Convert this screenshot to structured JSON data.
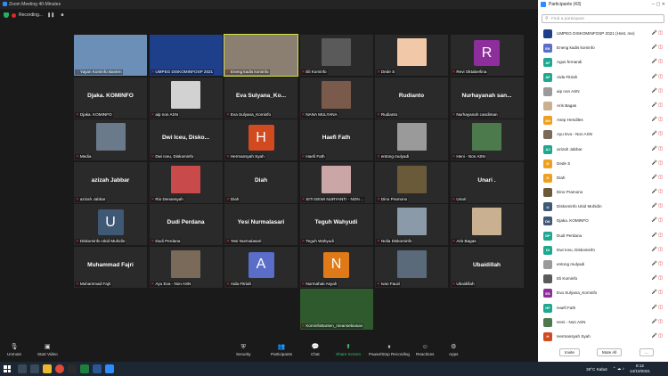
{
  "window": {
    "title": "Zoom Meeting 40-Minutes"
  },
  "recording": {
    "label": "Recording...",
    "pause_icon": "pause-icon",
    "stop_icon": "stop-icon"
  },
  "tiles": [
    {
      "name": "Yayan Kominfo Banten",
      "type": "photo",
      "color": "#6b8fb6"
    },
    {
      "name": "UMPEG DISKOMINFOSP 2021",
      "type": "photo",
      "color": "#1e3f8a"
    },
    {
      "name": "Eneng kadis kominfo",
      "type": "photo",
      "color": "#8a7f70",
      "active": true
    },
    {
      "name": "Eli Kominfo",
      "type": "photo",
      "color": "#5a5a5a"
    },
    {
      "name": "Dede S",
      "type": "photo",
      "color": "#f2c9a8"
    },
    {
      "name": "Revi Oktaberlina",
      "type": "avatar",
      "letter": "R",
      "color": "#8e2e9c"
    },
    {
      "name": "Djaka. KOMINFO",
      "type": "text",
      "big": "Djaka. KOMINFO"
    },
    {
      "name": "aip non ASN",
      "type": "photo",
      "color": "#d2d2d2"
    },
    {
      "name": "Eva Sulyana_Kominfo",
      "type": "text",
      "big": "Eva Sulyana_Ko..."
    },
    {
      "name": "NANA MULYANA",
      "type": "photo",
      "color": "#7a5a4a"
    },
    {
      "name": "Rudianto",
      "type": "text",
      "big": "Rudianto"
    },
    {
      "name": "Nurhayanah candiman",
      "type": "text",
      "big": "Nurhayanah san..."
    },
    {
      "name": "Media",
      "type": "photo",
      "color": "#6a7a8a"
    },
    {
      "name": "Dwi Iceu, Diskominfo",
      "type": "text",
      "big": "Dwi Iceu, Disko..."
    },
    {
      "name": "Hermansyah Syah",
      "type": "avatar",
      "letter": "H",
      "color": "#d24a1f"
    },
    {
      "name": "Haefi Fath",
      "type": "text",
      "big": "Haefi Fath"
    },
    {
      "name": "entong mulyadi",
      "type": "photo",
      "color": "#9a9a9a"
    },
    {
      "name": "Heni - Non ASN",
      "type": "photo",
      "color": "#4d7a4d"
    },
    {
      "name": "azizah Jabbar",
      "type": "text",
      "big": "azizah Jabbar"
    },
    {
      "name": "Rio Denansyah",
      "type": "photo",
      "color": "#c94a4a"
    },
    {
      "name": "Diah",
      "type": "text",
      "big": "Diah"
    },
    {
      "name": "SITI DEWI NURYANTI - NON ...",
      "type": "photo",
      "color": "#caa6a6"
    },
    {
      "name": "Dino Pramono",
      "type": "photo",
      "color": "#6a5a3a"
    },
    {
      "name": "Unari",
      "type": "text",
      "big": "Unari ."
    },
    {
      "name": "Diskominfo Ukid Muhidin",
      "type": "avatar",
      "letter": "U",
      "color": "#3f5873"
    },
    {
      "name": "Dudi Perdana",
      "type": "text",
      "big": "Dudi Perdana"
    },
    {
      "name": "Yesi Nurmalasari",
      "type": "text",
      "big": "Yesi Nurmalasari"
    },
    {
      "name": "Teguh Wahyudi",
      "type": "text",
      "big": "Teguh Wahyudi"
    },
    {
      "name": "Nolia Diskominfo",
      "type": "photo",
      "color": "#8a9aa8"
    },
    {
      "name": "Aris Bagas",
      "type": "photo",
      "color": "#c8b090"
    },
    {
      "name": "Muhammad Fajri",
      "type": "text",
      "big": "Muhammad Fajri"
    },
    {
      "name": "Ayu Eva - Non ASN",
      "type": "photo",
      "color": "#7a6a5a"
    },
    {
      "name": "Aida Fitriah",
      "type": "avatar",
      "letter": "A",
      "color": "#5a6ec9"
    },
    {
      "name": "Nurmahati Asyah",
      "type": "avatar",
      "letter": "N",
      "color": "#e07a18"
    },
    {
      "name": "Ivan Fauzi",
      "type": "photo",
      "color": "#5a6a7a"
    },
    {
      "name": "Ubaidillah",
      "type": "text",
      "big": "Ubaidillah"
    },
    {
      "name": "KominfoBanten_meansebiasan",
      "type": "photo",
      "color": "#2e5a2e"
    }
  ],
  "toolbar": {
    "unmute": "Unmute",
    "start_video": "Start Video",
    "security": "Security",
    "participants": "Participants",
    "participants_count": "43",
    "chat": "Chat",
    "share_screen": "Share Screen",
    "pause_recording": "Pause/Stop Recording",
    "reactions": "Reactions",
    "apps": "Apps"
  },
  "taskbar": {
    "weather": "30°C  Kabut",
    "time": "8:12",
    "date": "14/10/2021"
  },
  "panel": {
    "title": "Participants (43)",
    "search_placeholder": "Find a participant",
    "invite": "Invite",
    "mute_all": "Mute All",
    "more": "..."
  },
  "participants": [
    {
      "name": "UMPEG DISKOMINFOSP 2021 (Host, me)",
      "initials": "",
      "color": "#1e3f8a",
      "photo": true
    },
    {
      "name": "Eneng kadis kominfo",
      "initials": "EK",
      "color": "#5a6ec9",
      "photo": false
    },
    {
      "name": "Agus fernandi",
      "initials": "AF",
      "color": "#1fa88f",
      "photo": false
    },
    {
      "name": "Aida Fitriah",
      "initials": "AF",
      "color": "#1fa88f",
      "photo": false
    },
    {
      "name": "aip non ASN",
      "initials": "",
      "color": "#9a9a9a",
      "photo": true
    },
    {
      "name": "Aris Bagas",
      "initials": "",
      "color": "#c8b090",
      "photo": true
    },
    {
      "name": "Asep Hendiles",
      "initials": "AH",
      "color": "#f0a020",
      "photo": false
    },
    {
      "name": "Ayu Eva - Non ASN",
      "initials": "",
      "color": "#7a6a5a",
      "photo": true
    },
    {
      "name": "azizah Jabbar",
      "initials": "AJ",
      "color": "#1fa88f",
      "photo": false
    },
    {
      "name": "Dede S",
      "initials": "D",
      "color": "#f0a020",
      "photo": false
    },
    {
      "name": "Diah",
      "initials": "D",
      "color": "#f0a020",
      "photo": false
    },
    {
      "name": "Dino Pramono",
      "initials": "",
      "color": "#6a5a3a",
      "photo": true
    },
    {
      "name": "Diskominfo Ukid Muhidin",
      "initials": "U",
      "color": "#3f5873",
      "photo": false
    },
    {
      "name": "Djaka. KOMINFO",
      "initials": "DK",
      "color": "#3f5873",
      "photo": false
    },
    {
      "name": "Dudi Perdana",
      "initials": "DP",
      "color": "#1fa88f",
      "photo": false
    },
    {
      "name": "Dwi Iceu, Diskominfo",
      "initials": "DI",
      "color": "#1fa88f",
      "photo": false
    },
    {
      "name": "entong mulyadi",
      "initials": "",
      "color": "#9a9a9a",
      "photo": true
    },
    {
      "name": "Eli Kominfo",
      "initials": "",
      "color": "#5a5a5a",
      "photo": true
    },
    {
      "name": "Eva Sulyana_Kominfo",
      "initials": "ES",
      "color": "#8e2e9c",
      "photo": false
    },
    {
      "name": "Haefi Fath",
      "initials": "HF",
      "color": "#1fa88f",
      "photo": false
    },
    {
      "name": "Heni - Non ASN",
      "initials": "",
      "color": "#4d7a4d",
      "photo": true
    },
    {
      "name": "Hermansyah Syah",
      "initials": "H",
      "color": "#d24a1f",
      "photo": false
    }
  ]
}
